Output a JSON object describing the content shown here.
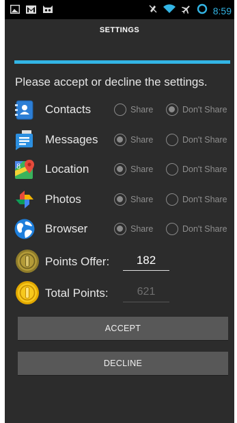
{
  "statusbar": {
    "time": "8:59",
    "icons": [
      "image-icon",
      "gmail-icon",
      "cyanogen-icon",
      "mute-icon",
      "wifi-icon",
      "airplane-icon",
      "sync-icon"
    ]
  },
  "header": {
    "title": "SETTINGS",
    "accent_color": "#33b5e5"
  },
  "prompt": "Please accept or decline the settings.",
  "share_label": "Share",
  "dont_share_label": "Don't Share",
  "permissions": [
    {
      "label": "Contacts",
      "icon": "contacts-icon",
      "selected": "dont_share"
    },
    {
      "label": "Messages",
      "icon": "messages-icon",
      "selected": "share"
    },
    {
      "label": "Location",
      "icon": "maps-location-icon",
      "selected": "share"
    },
    {
      "label": "Photos",
      "icon": "photos-pinwheel-icon",
      "selected": "share"
    },
    {
      "label": "Browser",
      "icon": "globe-icon",
      "selected": "share"
    }
  ],
  "points": {
    "offer_label": "Points Offer:",
    "offer_value": "182",
    "total_label": "Total Points:",
    "total_value": "621"
  },
  "buttons": {
    "accept": "ACCEPT",
    "decline": "DECLINE"
  }
}
